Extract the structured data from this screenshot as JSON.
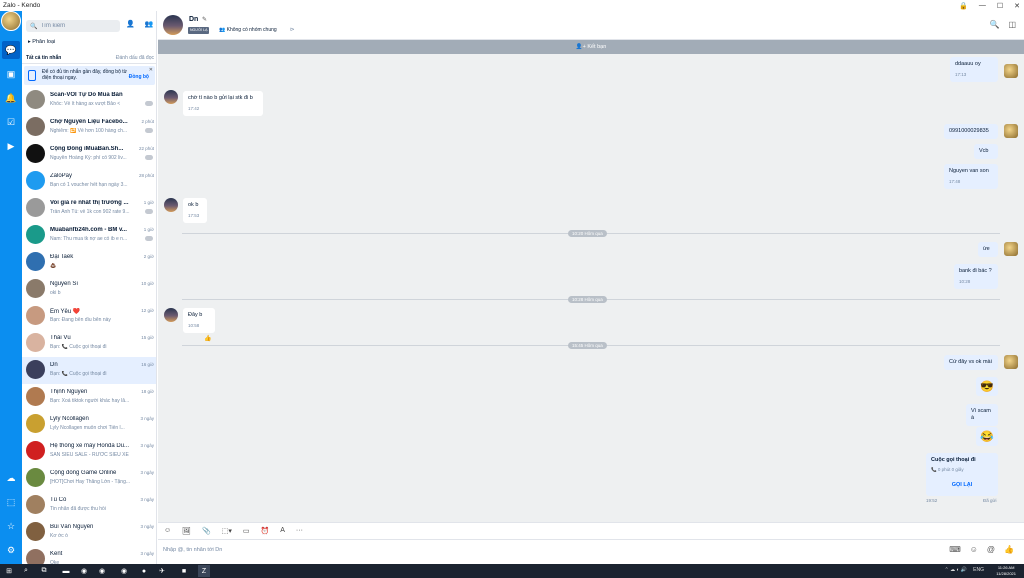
{
  "window": {
    "title": "Zalo - Kendo",
    "controls": [
      "🔒",
      "—",
      "☐",
      "✕"
    ]
  },
  "sidebar": {
    "search_placeholder": "Tìm kiếm",
    "phan_loai": "Phân loại",
    "tab_all": "Tất cả tin nhắn",
    "mark_read": "Đánh dấu đã đọc",
    "notice_text": "Để có đủ tin nhắn gần đây, đồng bộ từ điện thoại ngay.",
    "notice_action": "Đồng bộ",
    "conversations": [
      {
        "name": "Scan-VOI Tự Do Mua Bán",
        "preview": "Khốc: Về ít hàng ax vượt Bảo <",
        "time": "",
        "bold": true,
        "avatar": "#8f8a80"
      },
      {
        "name": "Chợ Nguyên Liệu Facebo...",
        "preview": "Nghiêm: 🔁 Về hơn 100 hàng ch...",
        "time": "2 phút",
        "bold": true,
        "avatar": "#7b6d62"
      },
      {
        "name": "Cộng Đồng iMuaBan.Sh...",
        "preview": "Nguyễn Hoàng Kỳ: phí cố 902 liv...",
        "time": "22 phút",
        "bold": true,
        "avatar": "#111111"
      },
      {
        "name": "ZaloPay",
        "preview": "Bạn có 1 voucher hết hạn ngày 3...",
        "time": "28 phút",
        "bold": false,
        "avatar": "#1e9bf0"
      },
      {
        "name": "Voi giá rẻ nhất thị trường ...",
        "preview": "Trần Anh Tú: về 1k con 902 rate 9...",
        "time": "1 giờ",
        "bold": true,
        "avatar": "#9a9a9a"
      },
      {
        "name": "Muabanfb24h.com - BM v...",
        "preview": "Nam: Thu mua tk nợ ae có ib e n...",
        "time": "1 giờ",
        "bold": true,
        "avatar": "#1a9a8a"
      },
      {
        "name": "Đại Taek",
        "preview": "💩",
        "time": "2 giờ",
        "bold": false,
        "avatar": "#2f6fb0"
      },
      {
        "name": "Nguyễn Sĩ",
        "preview": "oki b",
        "time": "10 giờ",
        "bold": false,
        "avatar": "#8a7a6a"
      },
      {
        "name": "Em Yêu ❤️",
        "preview": "Bạn: Đang bên dìu bên này",
        "time": "12 giờ",
        "bold": false,
        "avatar": "#c79a80"
      },
      {
        "name": "Thái Vũ",
        "preview": "Bạn: 📞 Cuộc gọi thoại đi",
        "time": "15 giờ",
        "bold": false,
        "avatar": "#d9b3a0"
      },
      {
        "name": "Dn",
        "preview": "Bạn: 📞 Cuộc gọi thoại đi",
        "time": "16 giờ",
        "bold": false,
        "avatar": "#3b3f5c",
        "active": true
      },
      {
        "name": "Thịnh Nguyễn",
        "preview": "Bạn: Xoá tiktok người khác hay lâ...",
        "time": "18 giờ",
        "bold": false,
        "avatar": "#b07a50"
      },
      {
        "name": "Lyly Ncollagen",
        "preview": "Lyly Ncollagen muốn chơi Tiến l...",
        "time": "3 ngày",
        "bold": false,
        "avatar": "#c9a030"
      },
      {
        "name": "Hệ thống xe máy Honda Du...",
        "preview": "SĂN SIÊU SALE - RƯỚC SIÊU XE",
        "time": "3 ngày",
        "bold": false,
        "avatar": "#d02020"
      },
      {
        "name": "Cộng đồng Game Online",
        "preview": "[HOT]Chơi Hay Thắng Lớn - Tặng...",
        "time": "3 ngày",
        "bold": false,
        "avatar": "#6a8a40"
      },
      {
        "name": "Tú Cò",
        "preview": "Tin nhắn đã được thu hồi",
        "time": "3 ngày",
        "bold": false,
        "avatar": "#a08060"
      },
      {
        "name": "Bùi Văn Nguyên",
        "preview": "Kơ ớc ò",
        "time": "3 ngày",
        "bold": false,
        "avatar": "#806040"
      },
      {
        "name": "Kent",
        "preview": "Oke",
        "time": "3 ngày",
        "bold": false,
        "avatar": "#907060"
      }
    ]
  },
  "chat": {
    "name": "Dn",
    "tag": "NGƯỜI LẠ",
    "group": "Không có nhóm chung",
    "add_friend": "Kết bạn",
    "input_placeholder": "Nhập @, tin nhắn tới Dn",
    "messages": [
      {
        "side": "me",
        "text": "ddaauu oy",
        "time": "17:13"
      },
      {
        "side": "them",
        "text": "chờ tí nào b gửi lại stk đi b",
        "time": "17:42"
      },
      {
        "side": "me",
        "text": "0991000029835",
        "time": ""
      },
      {
        "side": "me",
        "text": "Vcb",
        "time": ""
      },
      {
        "side": "me",
        "text": "Nguyen van son",
        "time": "17:48"
      },
      {
        "side": "them",
        "text": "ok b",
        "time": "17:53"
      },
      {
        "side": "me",
        "text": "ừe",
        "time": ""
      },
      {
        "side": "me",
        "text": "bank đi bác ?",
        "time": "10:28"
      },
      {
        "side": "them",
        "text": "Đây b",
        "time": "10:58"
      },
      {
        "side": "me",
        "text": "Cứ đây vs ok mài",
        "time": ""
      },
      {
        "side": "me",
        "text": "Vì scam à",
        "time": ""
      }
    ],
    "dividers": [
      "10:20 Hôm qua",
      "10:28 Hôm qua",
      "15:45 Hôm qua"
    ],
    "emojis": [
      "😎",
      "😂"
    ],
    "call": {
      "title": "Cuộc gọi thoại đi",
      "duration": "0 phút 0 giây",
      "recall": "GỌI LẠI",
      "time": "19:52",
      "status": "Đã gửi"
    }
  },
  "taskbar": {
    "time": "11:26 AM",
    "date": "11/28/2021",
    "lang": "ENG"
  }
}
